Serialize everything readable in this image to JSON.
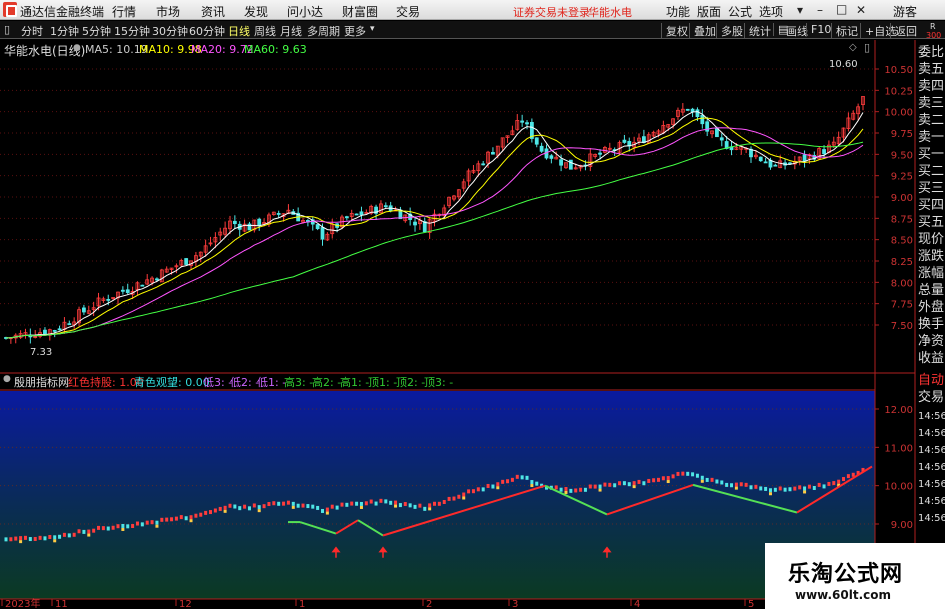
{
  "app": {
    "title": "通达信金融终端"
  },
  "menu": {
    "items": [
      "行情",
      "市场",
      "资讯",
      "发现",
      "问小达",
      "财富圈",
      "交易"
    ],
    "notice": "证券交易未登录",
    "stock_name": "华能水电",
    "right_items": [
      "功能",
      "版面",
      "公式",
      "选项"
    ],
    "user": "游客"
  },
  "toolbar": {
    "periods": [
      "分时",
      "1分钟",
      "5分钟",
      "15分钟",
      "30分钟",
      "60分钟",
      "日线",
      "周线",
      "月线",
      "多周期",
      "更多"
    ],
    "selected": "日线",
    "right": [
      "复权",
      "叠加",
      "多股",
      "统计",
      "画线",
      "F10",
      "标记",
      "+自选",
      "返回"
    ]
  },
  "main": {
    "title": "华能水电(日线)",
    "ma": [
      {
        "label": "MA5: 10.19",
        "color": "#ffffff"
      },
      {
        "label": "MA10: 9.98",
        "color": "#ffff00"
      },
      {
        "label": "MA20: 9.72",
        "color": "#ff55ff"
      },
      {
        "label": "MA60: 9.63",
        "color": "#44ff44"
      }
    ],
    "y_ticks": [
      "10.50",
      "10.25",
      "10.00",
      "9.75",
      "9.50",
      "9.25",
      "9.00",
      "8.75",
      "8.50",
      "8.25",
      "8.00",
      "7.75",
      "7.50"
    ],
    "high_label": "10.60",
    "low_label": "7.33"
  },
  "indicator": {
    "name": "殷朋指标网",
    "items": [
      {
        "label": "红色持股: 1.00",
        "color": "#ff3333"
      },
      {
        "label": "青色观望: 0.00",
        "color": "#33dddd"
      },
      {
        "label": "低3: -",
        "color": "#cc66ff"
      },
      {
        "label": "低2: -",
        "color": "#cc66ff"
      },
      {
        "label": "低1: -",
        "color": "#cc66ff"
      },
      {
        "label": "高3: -",
        "color": "#33cc33"
      },
      {
        "label": "高2: -",
        "color": "#33cc33"
      },
      {
        "label": "高1: -",
        "color": "#33cc33"
      },
      {
        "label": "顶1: -",
        "color": "#33cc33"
      },
      {
        "label": "顶2: -",
        "color": "#33cc33"
      },
      {
        "label": "顶3: -",
        "color": "#33cc33"
      }
    ],
    "y_ticks": [
      "12.00",
      "11.00",
      "10.00",
      "9.00"
    ]
  },
  "x_labels": [
    "2023年",
    "11",
    "12",
    "1",
    "2",
    "3",
    "4",
    "5"
  ],
  "side_panel": [
    "委比",
    "卖五",
    "卖四",
    "卖三",
    "卖二",
    "卖一",
    "买一",
    "买二",
    "买三",
    "买四",
    "买五",
    "现价",
    "涨跌",
    "涨幅",
    "总量",
    "外盘",
    "换手",
    "净资",
    "收益",
    "自动",
    "交易"
  ],
  "side_numbers": [
    "R",
    "300"
  ],
  "side_times": [
    "14:56",
    "14:56",
    "14:56",
    "14:56",
    "14:56",
    "14:56",
    "14:56"
  ],
  "watermark": {
    "line1": "乐淘公式网",
    "line2": "www.60lt.com"
  }
}
